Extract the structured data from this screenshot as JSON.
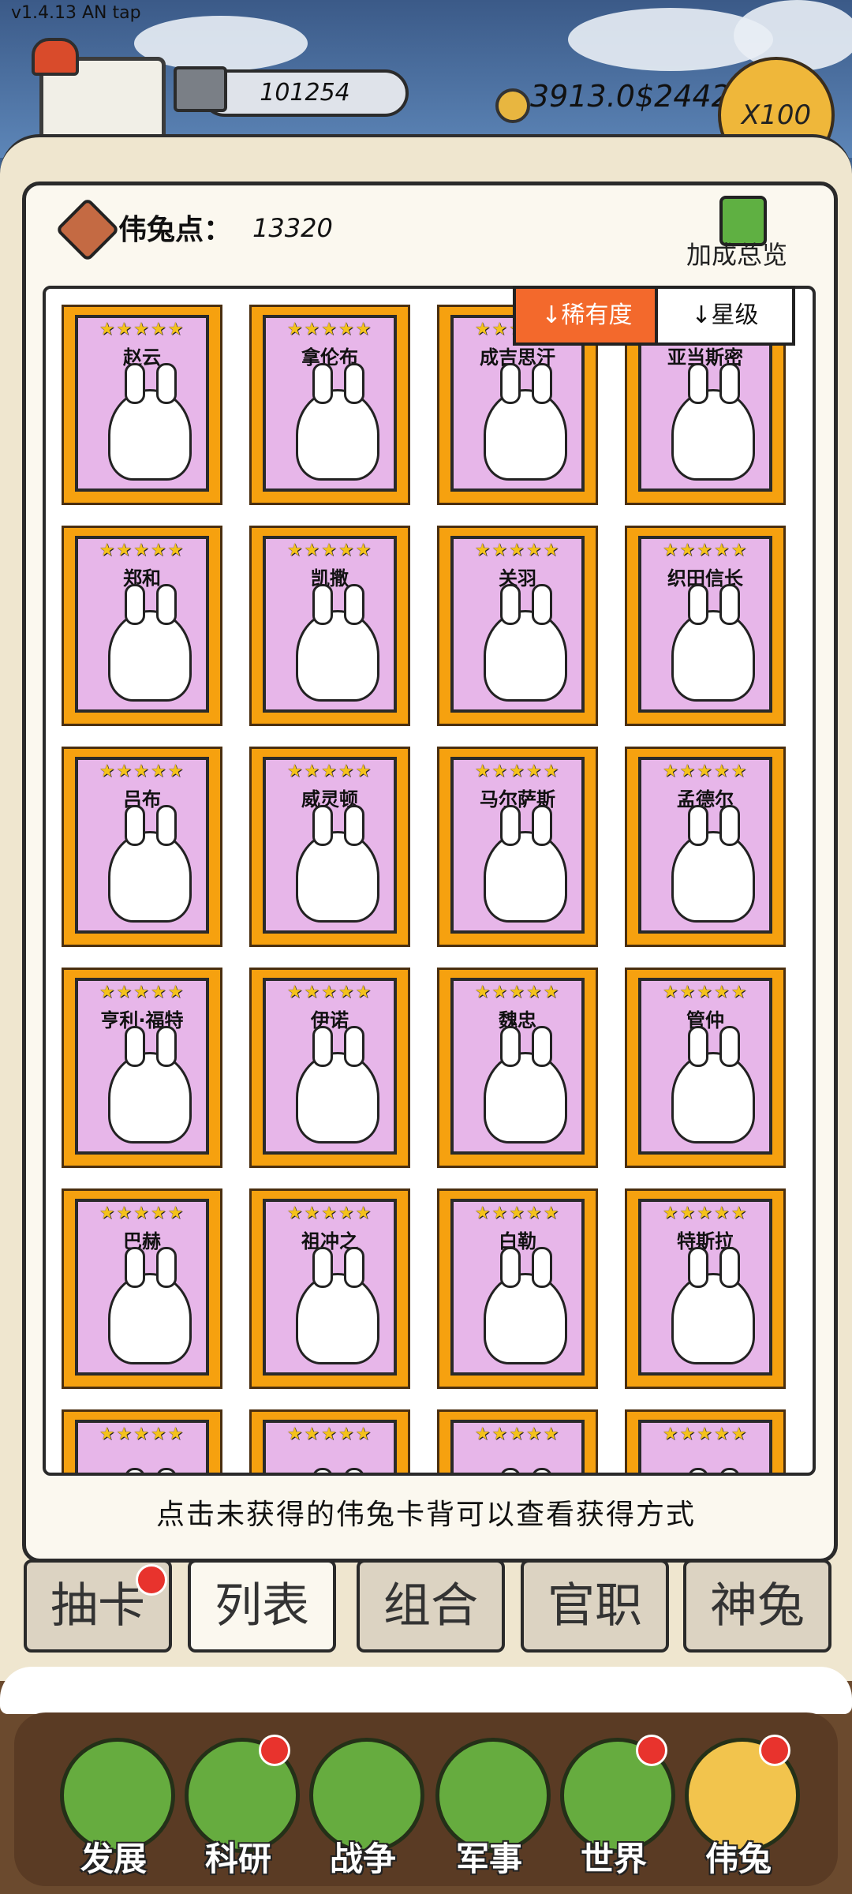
{
  "header": {
    "version": "v1.4.13 AN tap",
    "silver": "101254",
    "gold": "3913.0$2442",
    "multiplier": "X100"
  },
  "panel": {
    "points_label": "伟兔点：",
    "points_value": "13320",
    "bonus_label": "加成总览",
    "sort_rarity": "↓稀有度",
    "sort_star": "↓星级",
    "hint": "点击未获得的伟兔卡背可以查看获得方式"
  },
  "cards": [
    {
      "name": "赵云",
      "stars": "★★★★★"
    },
    {
      "name": "拿伦布",
      "stars": "★★★★★"
    },
    {
      "name": "成吉思汗",
      "stars": "★★★★★"
    },
    {
      "name": "亚当斯密",
      "stars": "★★★★★"
    },
    {
      "name": "郑和",
      "stars": "★★★★★"
    },
    {
      "name": "凯撒",
      "stars": "★★★★★"
    },
    {
      "name": "关羽",
      "stars": "★★★★★"
    },
    {
      "name": "织田信长",
      "stars": "★★★★★"
    },
    {
      "name": "吕布",
      "stars": "★★★★★"
    },
    {
      "name": "威灵顿",
      "stars": "★★★★★"
    },
    {
      "name": "马尔萨斯",
      "stars": "★★★★★"
    },
    {
      "name": "孟德尔",
      "stars": "★★★★★"
    },
    {
      "name": "亨利·福特",
      "stars": "★★★★★"
    },
    {
      "name": "伊诺",
      "stars": "★★★★★"
    },
    {
      "name": "魏忠",
      "stars": "★★★★★"
    },
    {
      "name": "管仲",
      "stars": "★★★★★"
    },
    {
      "name": "巴赫",
      "stars": "★★★★★"
    },
    {
      "name": "祖冲之",
      "stars": "★★★★★"
    },
    {
      "name": "白勒",
      "stars": "★★★★★"
    },
    {
      "name": "特斯拉",
      "stars": "★★★★★"
    },
    {
      "name": "",
      "stars": "★★★★★"
    },
    {
      "name": "",
      "stars": "★★★★★"
    },
    {
      "name": "",
      "stars": "★★★★★"
    },
    {
      "name": "",
      "stars": "★★★★★"
    }
  ],
  "tabs": [
    {
      "label": "抽卡"
    },
    {
      "label": "列表"
    },
    {
      "label": "组合"
    },
    {
      "label": "官职"
    },
    {
      "label": "神兔"
    }
  ],
  "nav": [
    {
      "label": "发展"
    },
    {
      "label": "科研"
    },
    {
      "label": "战争"
    },
    {
      "label": "军事"
    },
    {
      "label": "世界"
    },
    {
      "label": "伟兔"
    }
  ]
}
